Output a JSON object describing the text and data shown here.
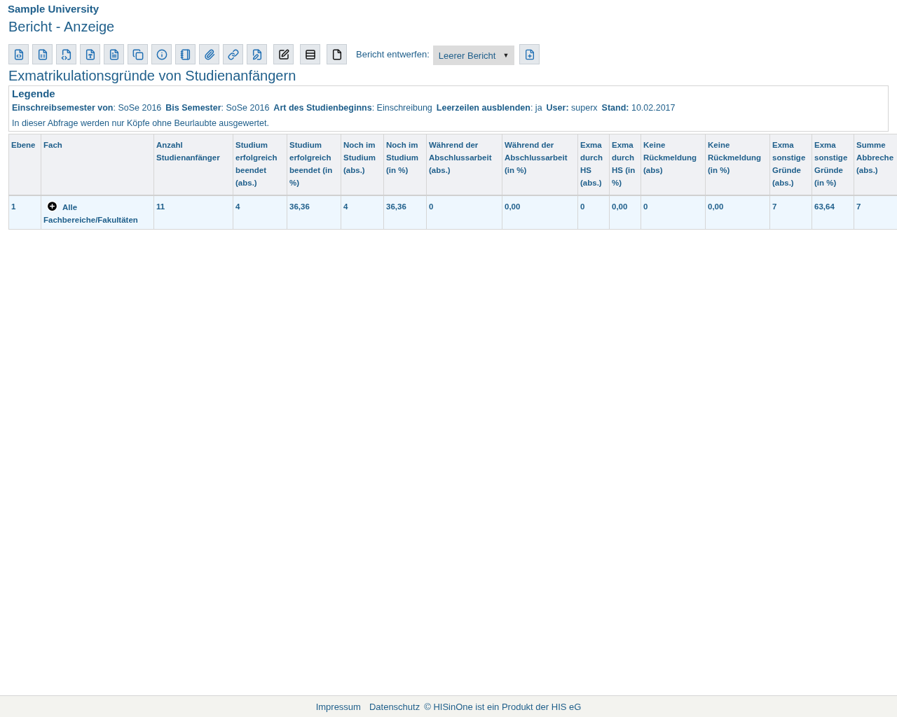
{
  "header": {
    "institution": "Sample University",
    "page_title": "Bericht - Anzeige"
  },
  "toolbar": {
    "design_label": "Bericht entwerfen:",
    "design_select": {
      "value": "Leerer Bericht",
      "caret": "▼"
    }
  },
  "report": {
    "title": "Exmatrikulationsgründe von Studienanfängern",
    "legend": {
      "title": "Legende",
      "params": [
        "**Einschreibsemester von**: SoSe 2016",
        "**Bis Semester**: SoSe 2016",
        "**Art des Studienbeginns**: Einschreibung",
        "**Leerzeilen ausblenden**: ja",
        "**User:** superx",
        "**Stand:** 10.02.2017"
      ],
      "note": "In dieser Abfrage werden nur Köpfe ohne Beurlaubte ausgewertet."
    },
    "table": {
      "columns": [
        "Ebene",
        "Fach",
        "Anzahl Studienanfänger",
        "Studium erfolgreich beendet (abs.)",
        "Studium erfolgreich beendet (in %)",
        "Noch im Studium (abs.)",
        "Noch im Studium (in %)",
        "Während der Abschlussarbeit (abs.)",
        "Während der Abschlussarbeit (in %)",
        "Exma durch HS (abs.)",
        "Exma durch HS (in %)",
        "Keine Rückmeldung (abs)",
        "Keine Rückmeldung (in %)",
        "Exma sonstige Gründe (abs.)",
        "Exma sonstige Gründe (in %)",
        "Summe Abbreche (abs.)"
      ],
      "rows": [
        {
          "expanded": false,
          "cells": [
            "1",
            "Alle Fachbereiche/Fakultäten",
            "11",
            "4",
            "36,36",
            "4",
            "36,36",
            "0",
            "0,00",
            "0",
            "0,00",
            "0",
            "0,00",
            "7",
            "63,64",
            "7"
          ]
        }
      ]
    }
  },
  "footer": {
    "links": [
      "Impressum",
      "Datenschutz"
    ],
    "copyright": "© HISinOne ist ein Produkt der HIS eG"
  }
}
